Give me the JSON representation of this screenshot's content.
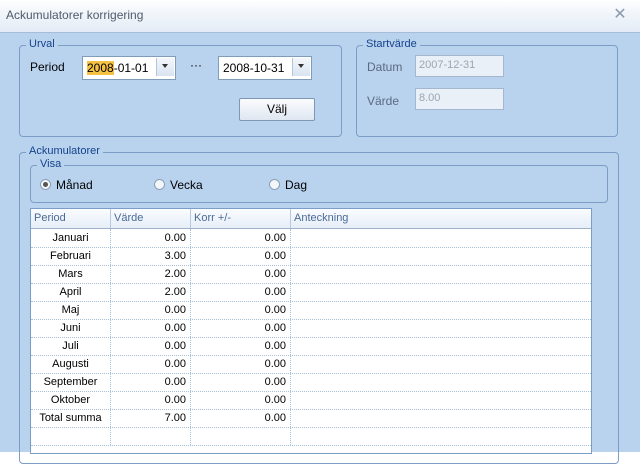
{
  "window": {
    "title": "Ackumulatorer korrigering"
  },
  "urval": {
    "legend": "Urval",
    "period_label": "Period",
    "from_date_highlight": "2008",
    "from_date_rest": "-01-01",
    "separator": "···",
    "to_date": "2008-10-31",
    "select_button": "Välj"
  },
  "startvarde": {
    "legend": "Startvärde",
    "datum_label": "Datum",
    "datum_value": "2007-12-31",
    "varde_label": "Värde",
    "varde_value": "8.00"
  },
  "ackumulatorer": {
    "legend": "Ackumulatorer",
    "visa": {
      "legend": "Visa",
      "options": [
        "Månad",
        "Vecka",
        "Dag"
      ],
      "selected": "Månad"
    },
    "grid": {
      "columns": [
        "Period",
        "Värde",
        "Korr +/-",
        "Anteckning"
      ],
      "rows": [
        [
          "Januari",
          "0.00",
          "0.00",
          ""
        ],
        [
          "Februari",
          "3.00",
          "0.00",
          ""
        ],
        [
          "Mars",
          "2.00",
          "0.00",
          ""
        ],
        [
          "April",
          "2.00",
          "0.00",
          ""
        ],
        [
          "Maj",
          "0.00",
          "0.00",
          ""
        ],
        [
          "Juni",
          "0.00",
          "0.00",
          ""
        ],
        [
          "Juli",
          "0.00",
          "0.00",
          ""
        ],
        [
          "Augusti",
          "0.00",
          "0.00",
          ""
        ],
        [
          "September",
          "0.00",
          "0.00",
          ""
        ],
        [
          "Oktober",
          "0.00",
          "0.00",
          ""
        ],
        [
          "Total summa",
          "7.00",
          "0.00",
          ""
        ]
      ]
    }
  }
}
